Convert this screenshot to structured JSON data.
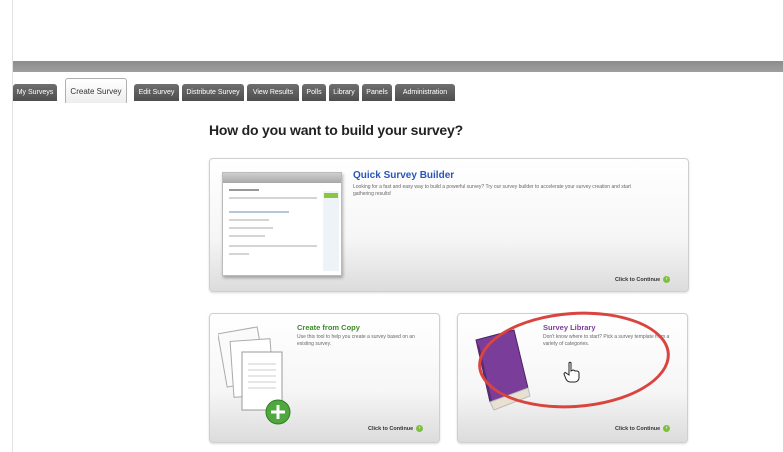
{
  "tabs": [
    {
      "label": "My Surveys"
    },
    {
      "label": "Create Survey"
    },
    {
      "label": "Edit Survey"
    },
    {
      "label": "Distribute Survey"
    },
    {
      "label": "View Results"
    },
    {
      "label": "Polls"
    },
    {
      "label": "Library"
    },
    {
      "label": "Panels"
    },
    {
      "label": "Administration"
    }
  ],
  "active_tab": "Create Survey",
  "main": {
    "heading": "How do you want to build your survey?",
    "cards": [
      {
        "title": "Quick Survey Builder",
        "description": "Looking for a fast and easy way to build a powerful survey? Try our survey builder to accelerate your survey creation and start gathering results!",
        "continue_label": "Click to Continue"
      },
      {
        "title": "Create from Copy",
        "description": "Use this tool to help you create a survey based on an existing survey.",
        "continue_label": "Click to Continue"
      },
      {
        "title": "Survey Library",
        "description": "Don't know where to start? Pick a survey template from a variety of categories.",
        "continue_label": "Click to Continue"
      }
    ]
  },
  "colors": {
    "tab_dark": "#5a5a5a",
    "title_blue": "#2a55b8",
    "title_green": "#3d8a2a",
    "title_purple": "#7a3e9a",
    "highlight_red": "#d9443f",
    "continue_green": "#7fbf3f"
  }
}
